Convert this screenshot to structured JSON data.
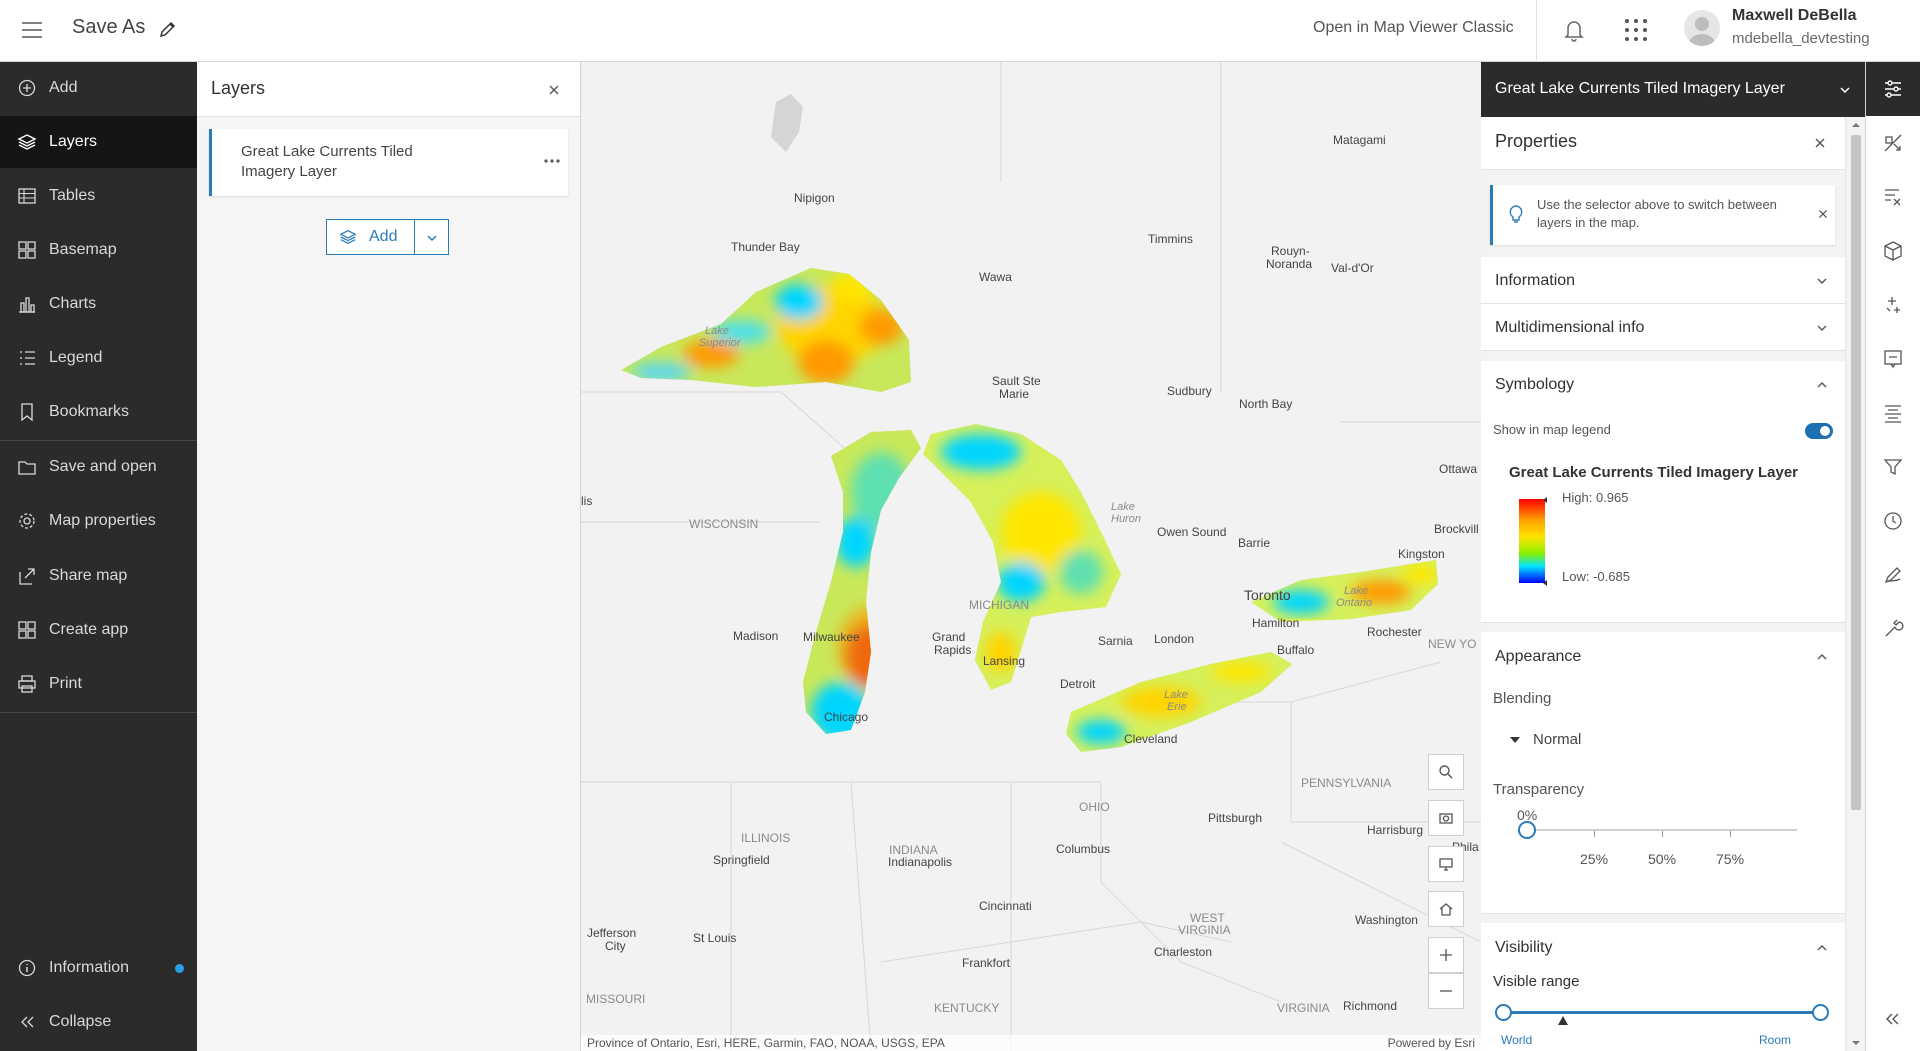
{
  "header": {
    "title": "Save As",
    "classic_link": "Open in Map Viewer Classic",
    "user_name": "Maxwell DeBella",
    "user_login": "mdebella_devtesting"
  },
  "nav": {
    "items": [
      {
        "label": "Add",
        "icon": "add-icon"
      },
      {
        "label": "Layers",
        "icon": "layers-icon"
      },
      {
        "label": "Tables",
        "icon": "table-icon"
      },
      {
        "label": "Basemap",
        "icon": "basemap-icon"
      },
      {
        "label": "Charts",
        "icon": "chart-icon"
      },
      {
        "label": "Legend",
        "icon": "legend-icon"
      },
      {
        "label": "Bookmarks",
        "icon": "bookmark-icon"
      },
      {
        "label": "Save and open",
        "icon": "folder-icon"
      },
      {
        "label": "Map properties",
        "icon": "gear-icon"
      },
      {
        "label": "Share map",
        "icon": "share-icon"
      },
      {
        "label": "Create app",
        "icon": "apps-icon"
      },
      {
        "label": "Print",
        "icon": "print-icon"
      }
    ],
    "active": "Layers",
    "info_label": "Information",
    "collapse_label": "Collapse"
  },
  "layers_panel": {
    "title": "Layers",
    "layer_name": "Great Lake Currents Tiled Imagery Layer",
    "add_label": "Add"
  },
  "map": {
    "labels": [
      "Matagami",
      "Nipigon",
      "Thunder Bay",
      "Timmins",
      "Rouyn-",
      "Noranda",
      "Val-d'Or",
      "Wawa",
      "Lake",
      "Superior",
      "Sault Ste",
      "Marie",
      "Sudbury",
      "North Bay",
      "Ottawa",
      "lis",
      "WISCONSIN",
      "Lake",
      "Huron",
      "Owen Sound",
      "Barrie",
      "Kingston",
      "Brockvill",
      "MICHIGAN",
      "Toronto",
      "Lake",
      "Ontario",
      "Hamilton",
      "Rochester",
      "NEW YO",
      "Madison",
      "Milwaukee",
      "Grand",
      "Rapids",
      "Lansing",
      "Sarnia",
      "London",
      "Buffalo",
      "Detroit",
      "Lake",
      "Erie",
      "Chicago",
      "Cleveland",
      "PENNSYLVANIA",
      "OHIO",
      "Pittsburgh",
      "Harrisburg",
      "Phila",
      "ILLINOIS",
      "Springfield",
      "INDIANA",
      "Indianapolis",
      "Columbus",
      "Cincinnati",
      "WEST",
      "VIRGINIA",
      "Washington",
      "Charleston",
      "Jefferson",
      "City",
      "St Louis",
      "Frankfort",
      "MISSOURI",
      "KENTUCKY",
      "VIRGINIA",
      "Richmond"
    ],
    "attribution": "Province of Ontario, Esri, HERE, Garmin, FAO, NOAA, USGS, EPA",
    "powered_by": "Powered by Esri"
  },
  "properties": {
    "layer_selector": "Great Lake Currents Tiled Imagery Layer",
    "title": "Properties",
    "notice": "Use the selector above to switch between layers in the map.",
    "information": "Information",
    "multidimensional": "Multidimensional info",
    "symbology": "Symbology",
    "show_legend": "Show in map legend",
    "show_legend_on": true,
    "legend_title": "Great Lake Currents Tiled Imagery Layer",
    "legend_high": "High: 0.965",
    "legend_low": "Low: -0.685",
    "appearance": "Appearance",
    "blending": "Blending",
    "blend_value": "Normal",
    "transparency": "Transparency",
    "transparency_value": "0%",
    "transparency_level": 0,
    "ticks": [
      "25%",
      "50%",
      "75%"
    ],
    "visibility": "Visibility",
    "visible_range": "Visible range",
    "range_min": "World",
    "range_max": "Room"
  },
  "colors": {
    "accent": "#2b7bb9",
    "nav_bg": "#2b2b2b",
    "ramp": [
      "#ff0000",
      "#ffe400",
      "#00e5ff",
      "#0000ff"
    ]
  }
}
